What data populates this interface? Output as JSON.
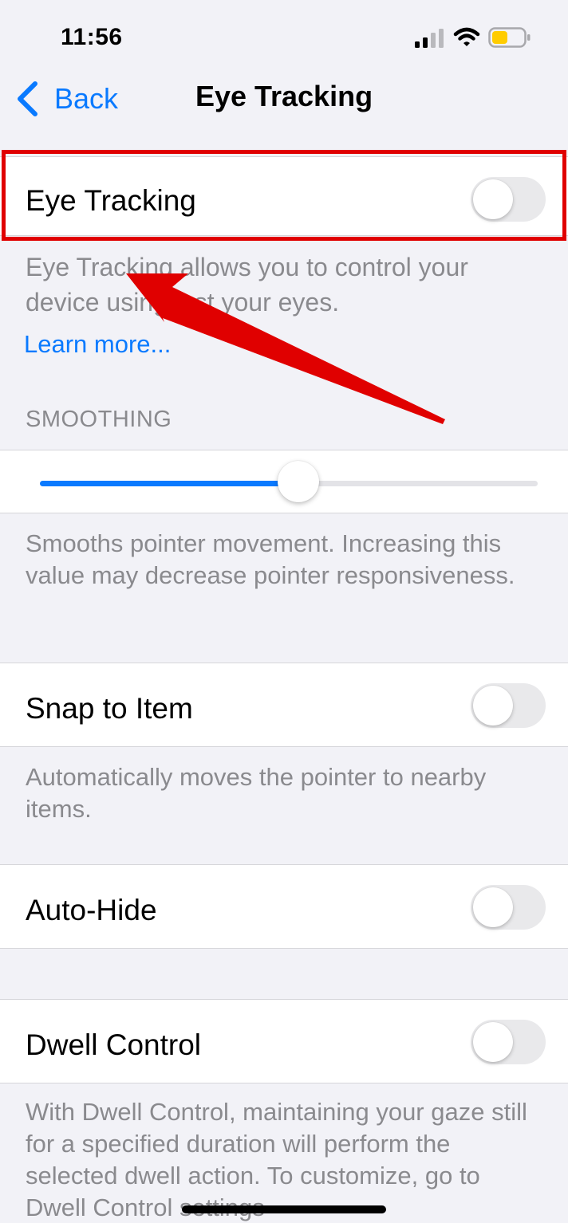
{
  "status_bar": {
    "time": "11:56",
    "signal_icon": "cellular-signal-icon",
    "wifi_icon": "wifi-icon",
    "battery_icon": "battery-icon",
    "battery_color": "#ffcc00"
  },
  "nav": {
    "back_label": "Back",
    "title": "Eye Tracking"
  },
  "eye_tracking": {
    "label": "Eye Tracking",
    "enabled": false,
    "description": "Eye Tracking allows you to control your device using just your eyes.",
    "learn_more": "Learn more..."
  },
  "smoothing": {
    "header": "SMOOTHING",
    "value_fraction": 0.52,
    "footer": "Smooths pointer movement. Increasing this value may decrease pointer responsiveness."
  },
  "snap_to_item": {
    "label": "Snap to Item",
    "enabled": false,
    "footer": "Automatically moves the pointer to nearby items."
  },
  "auto_hide": {
    "label": "Auto-Hide",
    "enabled": false
  },
  "dwell_control": {
    "label": "Dwell Control",
    "enabled": false,
    "footer": "With Dwell Control, maintaining your gaze still for a specified duration will perform the selected dwell action. To customize, go to Dwell Control settings"
  },
  "colors": {
    "accent": "#0a7aff",
    "annotation": "#e00000",
    "toggle_off": "#e9e9eb",
    "secondary_text": "#8a8a8e"
  }
}
